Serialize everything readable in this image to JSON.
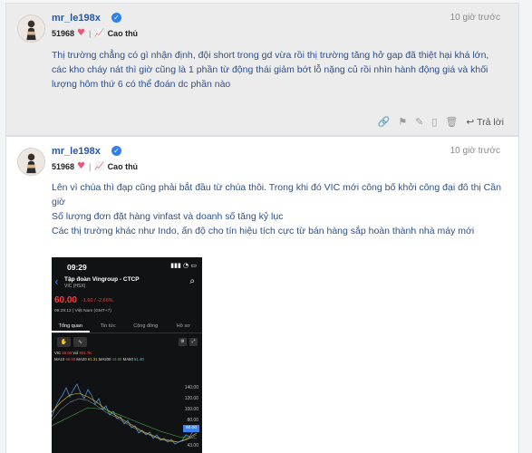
{
  "posts": [
    {
      "username": "mr_le198x",
      "points": "51968",
      "rank": "Cao thủ",
      "time": "10 giờ trước",
      "text": "Thị trường chẳng có gì nhận định, đội short trong gd vừa rồi thị trường tăng hở gap đã thiệt hại khá lớn, các kho cháy nát thì giờ cũng là 1 phần từ động thái giảm bớt lỗ nặng củ rồi nhìn hành động giá và khối lượng hôm thứ 6 có thể đoán dc phần nào",
      "reply_label": "Trả lời"
    },
    {
      "username": "mr_le198x",
      "points": "51968",
      "rank": "Cao thủ",
      "time": "10 giờ trước",
      "lines": [
        "Lên vì chúa thì đạp cũng phải bắt đầu từ chúa thôi. Trong khi đó VIC mới công bố khởi công đại đô thị Cần giờ",
        "Số lượng đơn đặt hàng vinfast và doanh số tăng kỷ lục",
        "Các thị trường khác như Indo, ấn độ cho tín hiệu tích cực từ bán hàng sắp hoàn thành nhà máy mới"
      ]
    }
  ],
  "icons": {
    "verified": "verified-badge-icon",
    "heart": "heart-icon",
    "rank": "chart-rank-icon",
    "link": "link-icon",
    "flag": "flag-icon",
    "edit": "pencil-icon",
    "delete": "trash-icon",
    "reply": "reply-arrow-icon"
  },
  "screenshot": {
    "time": "09:29",
    "title": "Tập đoàn Vingroup - CTCP",
    "subtitle": "VIC (HSX)",
    "price": "60.00",
    "change": "-1.60 / -2.66%",
    "clock": "09:29:12 | Việt Nam (GMT+7)",
    "tabs": [
      "Tổng quan",
      "Tin tức",
      "Cộng đồng",
      "Hồ sơ"
    ],
    "ma_line1": {
      "label": "VIC",
      "value": "60.00",
      "vol_label": "Vol",
      "vol": "831.7K"
    },
    "ma_line2": [
      {
        "label": "MA10",
        "value": "60.00"
      },
      {
        "label": "MA20",
        "value": "61.31"
      },
      {
        "label": "MA200",
        "value": "43.88"
      },
      {
        "label": "MA50",
        "value": "51.40"
      }
    ],
    "axis": [
      "140.00",
      "120.00",
      "100.00",
      "80.00",
      "60.00",
      "43.00"
    ],
    "price_tag": "60.00"
  }
}
